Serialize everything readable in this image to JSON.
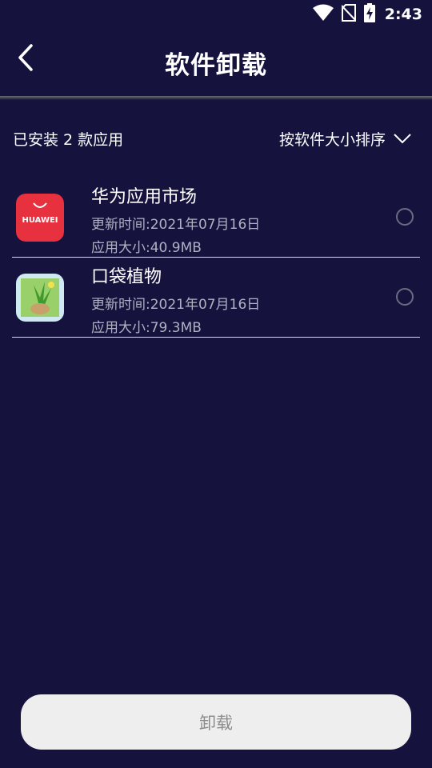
{
  "status_bar": {
    "time": "2:43",
    "icons": [
      "wifi-icon",
      "no-sim-icon",
      "battery-charging-icon"
    ]
  },
  "header": {
    "back_icon": "chevron-left-icon",
    "title": "软件卸载"
  },
  "summary": {
    "installed_text": "已安装 2 款应用",
    "sort_label": "按软件大小排序",
    "sort_icon": "chevron-down-icon"
  },
  "apps": [
    {
      "name": "华为应用市场",
      "updated": "更新时间:2021年07月16日",
      "size": "应用大小:40.9MB",
      "icon_text": "HUAWEI",
      "icon_color": "#e8313f"
    },
    {
      "name": "口袋植物",
      "updated": "更新时间:2021年07月16日",
      "size": "应用大小:79.3MB",
      "icon_color": "#7cc24a"
    }
  ],
  "actions": {
    "uninstall_label": "卸载"
  },
  "colors": {
    "background": "#15133d",
    "button_bg": "#eeeeee",
    "button_text": "#8c8c8c"
  }
}
